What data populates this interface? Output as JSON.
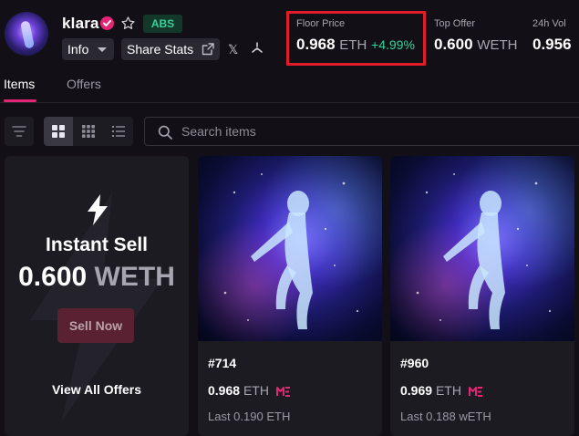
{
  "header": {
    "collection_name": "klara",
    "chain_badge": "ABS",
    "info_label": "Info",
    "share_label": "Share Stats",
    "social_x": "𝕏"
  },
  "stats": {
    "floor": {
      "label": "Floor Price",
      "value": "0.968",
      "unit": "ETH",
      "change": "+4.99%"
    },
    "top_offer": {
      "label": "Top Offer",
      "value": "0.600",
      "unit": "WETH"
    },
    "vol_24h": {
      "label": "24h Vol",
      "value": "0.956"
    }
  },
  "tabs": [
    {
      "label": "Items",
      "active": true
    },
    {
      "label": "Offers",
      "active": false
    }
  ],
  "search": {
    "placeholder": "Search items"
  },
  "instant_sell": {
    "title": "Instant Sell",
    "value": "0.600",
    "unit": "WETH",
    "button_label": "Sell Now",
    "view_offers_label": "View All Offers"
  },
  "items": [
    {
      "id": "#714",
      "price": "0.968",
      "unit": "ETH",
      "last": "Last 0.190 ETH"
    },
    {
      "id": "#960",
      "price": "0.969",
      "unit": "ETH",
      "last": "Last 0.188 wETH"
    }
  ],
  "colors": {
    "accent": "#e42575",
    "positive": "#34d399",
    "highlight_box": "#e11d2a",
    "background": "#121016",
    "card": "#1d1b22"
  },
  "icons": {
    "verified": "verified-check-icon",
    "favorite": "star-icon",
    "share": "share-out-icon",
    "blur": "blur-marketplace-icon",
    "filter": "filter-icon",
    "search": "search-icon",
    "instant_sell": "lightning-bolt-icon",
    "marketplace": "magic-eden-icon"
  }
}
